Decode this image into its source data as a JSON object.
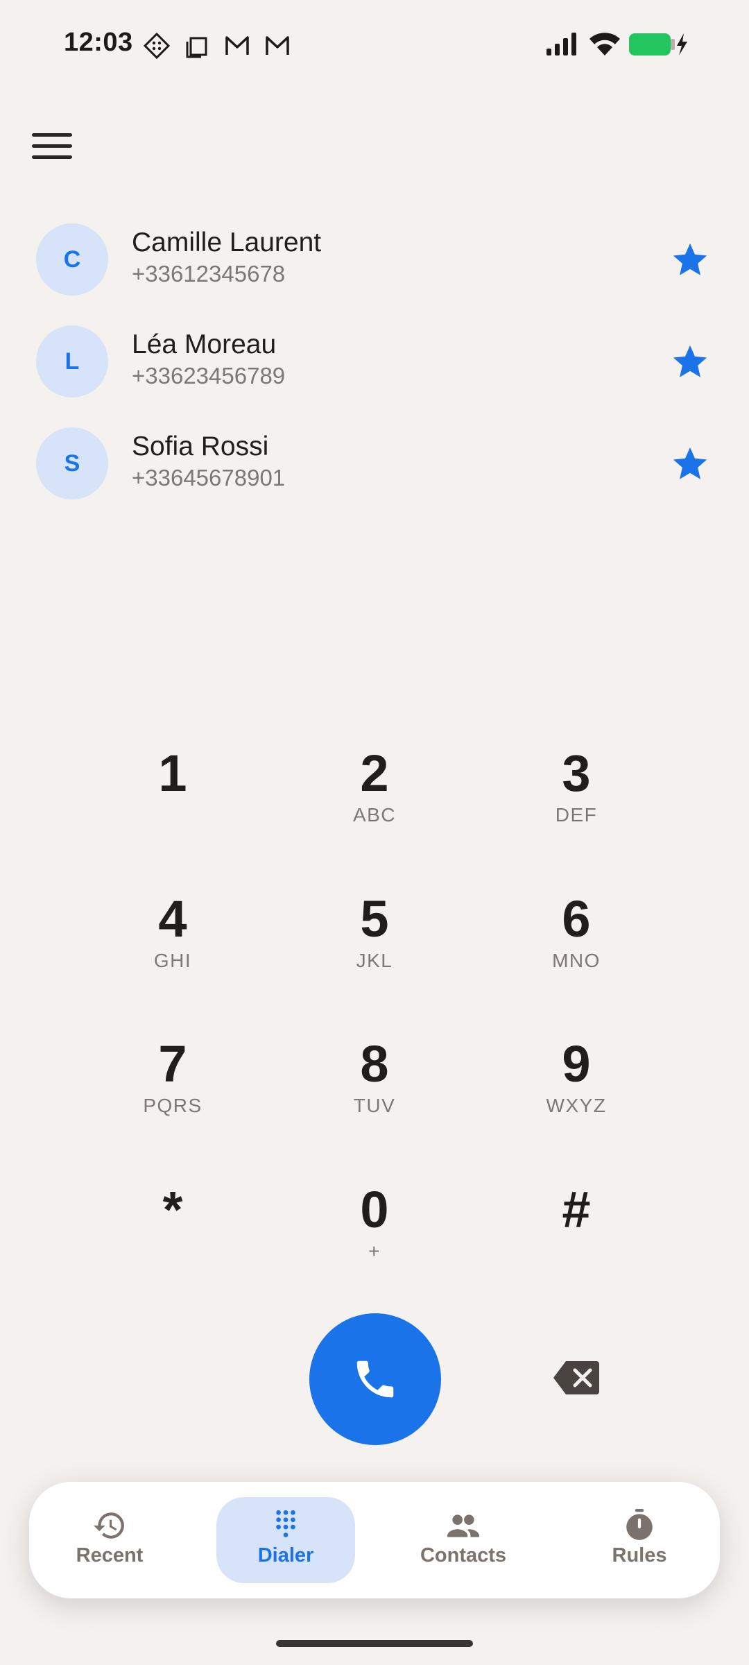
{
  "status_bar": {
    "time": "12:03",
    "left_icons": [
      "diamond-grid-icon",
      "copy-icon",
      "gmail-icon",
      "gmail-icon"
    ],
    "right_icons": [
      "signal-icon",
      "wifi-icon",
      "battery-charging-icon"
    ],
    "battery_color": "#22c55e"
  },
  "favorites": [
    {
      "initial": "C",
      "name": "Camille Laurent",
      "number": "+33612345678"
    },
    {
      "initial": "L",
      "name": "Léa Moreau",
      "number": "+33623456789"
    },
    {
      "initial": "S",
      "name": "Sofia Rossi",
      "number": "+33645678901"
    }
  ],
  "keypad": [
    {
      "digit": "1",
      "letters": ""
    },
    {
      "digit": "2",
      "letters": "ABC"
    },
    {
      "digit": "3",
      "letters": "DEF"
    },
    {
      "digit": "4",
      "letters": "GHI"
    },
    {
      "digit": "5",
      "letters": "JKL"
    },
    {
      "digit": "6",
      "letters": "MNO"
    },
    {
      "digit": "7",
      "letters": "PQRS"
    },
    {
      "digit": "8",
      "letters": "TUV"
    },
    {
      "digit": "9",
      "letters": "WXYZ"
    },
    {
      "digit": "*",
      "letters": ""
    },
    {
      "digit": "0",
      "letters": "+"
    },
    {
      "digit": "#",
      "letters": ""
    }
  ],
  "nav": {
    "items": [
      {
        "label": "Recent",
        "icon": "history-icon"
      },
      {
        "label": "Dialer",
        "icon": "dialpad-icon"
      },
      {
        "label": "Contacts",
        "icon": "people-icon"
      },
      {
        "label": "Rules",
        "icon": "timer-icon"
      }
    ],
    "active": "Dialer"
  },
  "colors": {
    "accent": "#1a73e8",
    "avatar_bg": "#d6e3f8",
    "background": "#f4f1ef",
    "star": "#1a73e8"
  }
}
